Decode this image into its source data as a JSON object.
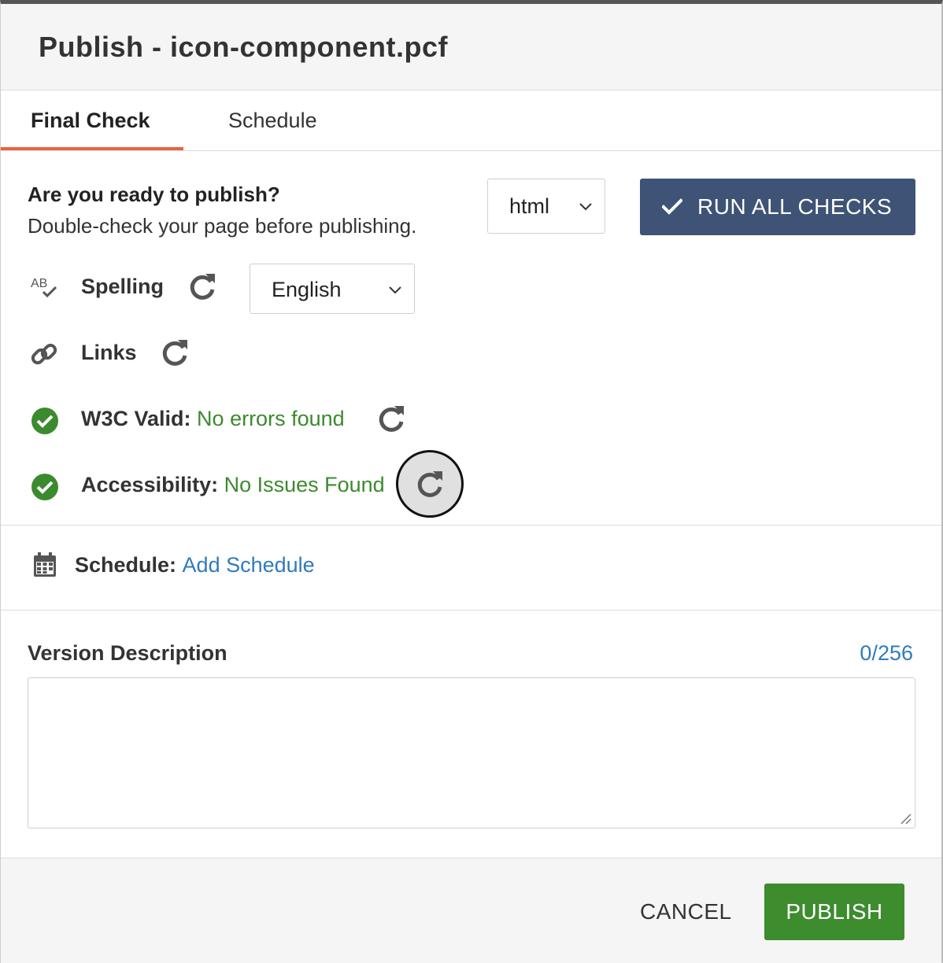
{
  "dialog": {
    "title": "Publish - icon-component.pcf"
  },
  "tabs": [
    {
      "label": "Final Check",
      "active": true
    },
    {
      "label": "Schedule",
      "active": false
    }
  ],
  "final_check": {
    "heading": "Are you ready to publish?",
    "subheading": "Double-check your page before publishing.",
    "format_select": {
      "value": "html"
    },
    "run_all_button": {
      "label": "RUN ALL CHECKS",
      "icon": "check-icon"
    },
    "checks": [
      {
        "name": "Spelling",
        "icon": "spellcheck-icon",
        "result": "",
        "language_select": {
          "value": "English"
        }
      },
      {
        "name": "Links",
        "icon": "link-icon",
        "result": ""
      },
      {
        "name": "W3C Valid:",
        "icon": "check-circle-icon",
        "result": "No errors found"
      },
      {
        "name": "Accessibility:",
        "icon": "check-circle-icon",
        "result": "No Issues Found"
      }
    ]
  },
  "schedule": {
    "label": "Schedule:",
    "link": "Add Schedule",
    "icon": "calendar-icon"
  },
  "version_description": {
    "label": "Version Description",
    "counter": "0/256",
    "value": "",
    "placeholder": ""
  },
  "footer": {
    "cancel_label": "CANCEL",
    "publish_label": "PUBLISH"
  },
  "colors": {
    "tab_accent": "#e8643f",
    "primary_button": "#3e5375",
    "publish_button": "#3d8c2e",
    "success_text": "#3c8a2e",
    "link": "#2f7ac0"
  }
}
